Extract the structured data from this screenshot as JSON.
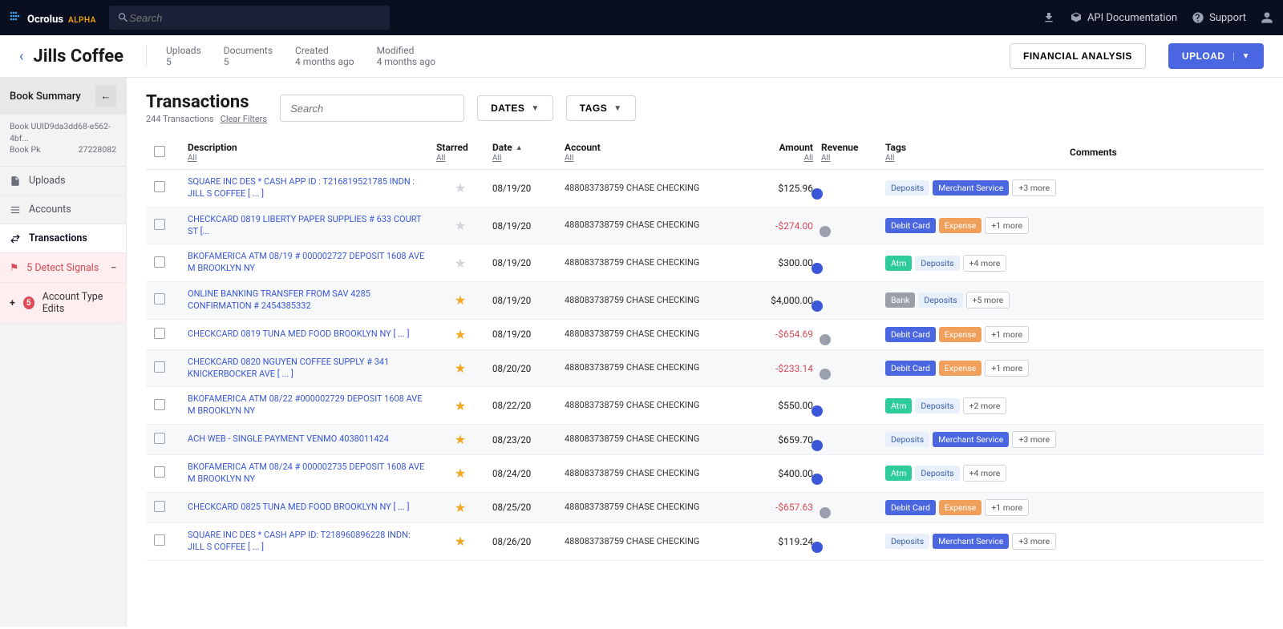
{
  "topbar": {
    "brand": "Ocrolus",
    "brand_sub": "ALPHA",
    "search_placeholder": "Search",
    "api_link": "API Documentation",
    "support_link": "Support"
  },
  "header": {
    "title": "Jills Coffee",
    "meta": [
      {
        "label": "Uploads",
        "value": "5"
      },
      {
        "label": "Documents",
        "value": "5"
      },
      {
        "label": "Created",
        "value": "4 months ago"
      },
      {
        "label": "Modified",
        "value": "4 months ago"
      }
    ],
    "btn_financial": "FINANCIAL ANALYSIS",
    "btn_upload": "UPLOAD"
  },
  "sidebar": {
    "summary": "Book Summary",
    "uuid_label": "Book UUID9da3dd68-e562-4bf...",
    "pk_label": "Book Pk",
    "pk_value": "27228082",
    "items": {
      "uploads": "Uploads",
      "accounts": "Accounts",
      "transactions": "Transactions",
      "detect": "5 Detect Signals",
      "edits_count": "5",
      "edits": "Account Type Edits"
    }
  },
  "toolbar": {
    "title": "Transactions",
    "count": "244 Transactions",
    "clear": "Clear Filters",
    "search_placeholder": "Search",
    "dates_btn": "DATES",
    "tags_btn": "TAGS"
  },
  "columns": {
    "description": "Description",
    "starred": "Starred",
    "date": "Date",
    "account": "Account",
    "amount": "Amount",
    "revenue": "Revenue",
    "tags": "Tags",
    "comments": "Comments",
    "all": "All"
  },
  "account_display": "488083738759 CHASE CHECKING",
  "rows": [
    {
      "desc": "SQUARE INC DES * CASH APP ID : T216819521785 INDN : JILL S COFFEE [ ... ]",
      "starred": false,
      "date": "08/19/20",
      "amount": "$125.96",
      "neg": false,
      "revenue": true,
      "tags": [
        {
          "t": "Deposits",
          "c": "deposits"
        },
        {
          "t": "Merchant Service",
          "c": "merchant"
        },
        {
          "t": "+3 more",
          "c": "more"
        }
      ]
    },
    {
      "desc": "CHECKCARD 0819 LIBERTY PAPER SUPPLIES # 633 COURT ST [...",
      "starred": false,
      "date": "08/19/20",
      "amount": "-$274.00",
      "neg": true,
      "revenue": false,
      "tags": [
        {
          "t": "Debit Card",
          "c": "debit"
        },
        {
          "t": "Expense",
          "c": "expense"
        },
        {
          "t": "+1 more",
          "c": "more"
        }
      ]
    },
    {
      "desc": "BKOFAMERICA ATM 08/19 # 000002727 DEPOSIT 1608 AVE M BROOKLYN NY",
      "starred": false,
      "date": "08/19/20",
      "amount": "$300.00",
      "neg": false,
      "revenue": true,
      "tags": [
        {
          "t": "Atm",
          "c": "atm"
        },
        {
          "t": "Deposits",
          "c": "deposits"
        },
        {
          "t": "+4 more",
          "c": "more"
        }
      ]
    },
    {
      "desc": "ONLINE BANKING TRANSFER FROM SAV 4285 CONFIRMATION # 2454385332",
      "starred": true,
      "date": "08/19/20",
      "amount": "$4,000.00",
      "neg": false,
      "revenue": true,
      "tags": [
        {
          "t": "Bank",
          "c": "bank"
        },
        {
          "t": "Deposits",
          "c": "deposits"
        },
        {
          "t": "+5 more",
          "c": "more"
        }
      ]
    },
    {
      "desc": "CHECKCARD 0819 TUNA MED FOOD BROOKLYN NY [ ... ]",
      "starred": true,
      "date": "08/19/20",
      "amount": "-$654.69",
      "neg": true,
      "revenue": false,
      "tags": [
        {
          "t": "Debit Card",
          "c": "debit"
        },
        {
          "t": "Expense",
          "c": "expense"
        },
        {
          "t": "+1 more",
          "c": "more"
        }
      ]
    },
    {
      "desc": "CHECKCARD 0820 NGUYEN COFFEE SUPPLY # 341 KNICKERBOCKER AVE [ ... ]",
      "starred": true,
      "date": "08/20/20",
      "amount": "-$233.14",
      "neg": true,
      "revenue": false,
      "tags": [
        {
          "t": "Debit Card",
          "c": "debit"
        },
        {
          "t": "Expense",
          "c": "expense"
        },
        {
          "t": "+1 more",
          "c": "more"
        }
      ]
    },
    {
      "desc": "BKOFAMERICA ATM 08/22 #000002729 DEPOSIT 1608 AVE M BROOKLYN NY",
      "starred": true,
      "date": "08/22/20",
      "amount": "$550.00",
      "neg": false,
      "revenue": true,
      "tags": [
        {
          "t": "Atm",
          "c": "atm"
        },
        {
          "t": "Deposits",
          "c": "deposits"
        },
        {
          "t": "+2 more",
          "c": "more"
        }
      ]
    },
    {
      "desc": "ACH WEB - SINGLE PAYMENT VENMO 4038011424",
      "starred": true,
      "date": "08/23/20",
      "amount": "$659.70",
      "neg": false,
      "revenue": true,
      "tags": [
        {
          "t": "Deposits",
          "c": "deposits"
        },
        {
          "t": "Merchant Service",
          "c": "merchant"
        },
        {
          "t": "+3 more",
          "c": "more"
        }
      ]
    },
    {
      "desc": "BKOFAMERICA ATM 08/24 # 000002735 DEPOSIT 1608 AVE M BROOKLYN NY",
      "starred": true,
      "date": "08/24/20",
      "amount": "$400.00",
      "neg": false,
      "revenue": true,
      "tags": [
        {
          "t": "Atm",
          "c": "atm"
        },
        {
          "t": "Deposits",
          "c": "deposits"
        },
        {
          "t": "+4 more",
          "c": "more"
        }
      ]
    },
    {
      "desc": "CHECKCARD 0825 TUNA MED FOOD BROOKLYN NY [ ... ]",
      "starred": true,
      "date": "08/25/20",
      "amount": "-$657.63",
      "neg": true,
      "revenue": false,
      "tags": [
        {
          "t": "Debit Card",
          "c": "debit"
        },
        {
          "t": "Expense",
          "c": "expense"
        },
        {
          "t": "+1 more",
          "c": "more"
        }
      ]
    },
    {
      "desc": "SQUARE INC DES * CASH APP ID: T218960896228 INDN: JILL S COFFEE [ ... ]",
      "starred": true,
      "date": "08/26/20",
      "amount": "$119.24",
      "neg": false,
      "revenue": true,
      "tags": [
        {
          "t": "Deposits",
          "c": "deposits"
        },
        {
          "t": "Merchant Service",
          "c": "merchant"
        },
        {
          "t": "+3 more",
          "c": "more"
        }
      ]
    }
  ]
}
